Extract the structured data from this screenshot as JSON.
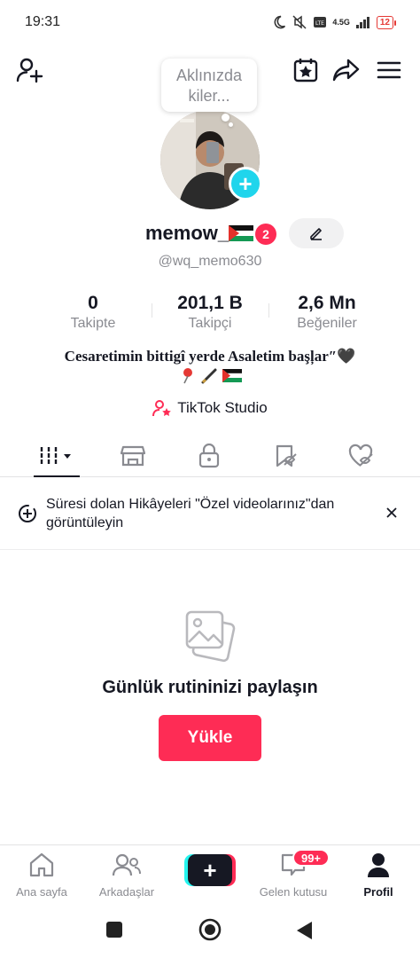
{
  "status_bar": {
    "time": "19:31",
    "battery": "12",
    "network": "4.5G"
  },
  "profile": {
    "bubble_text": "Aklınızda kiler...",
    "username": "memow_",
    "notification_count": "2",
    "handle": "@wq_memo630",
    "stats": [
      {
        "value": "0",
        "label": "Takipte"
      },
      {
        "value": "201,1 B",
        "label": "Takipçi"
      },
      {
        "value": "2,6 Mn",
        "label": "Beğeniler"
      }
    ],
    "bio": "Cesaretimin bittigî yerde Asaletim başļar″🖤",
    "studio_label": "TikTok Studio"
  },
  "banner": {
    "text": "Süresi dolan Hikâyeleri \"Özel videolarınız\"dan görüntüleyin"
  },
  "empty_state": {
    "title": "Günlük rutininizi paylaşın",
    "button": "Yükle"
  },
  "bottom_nav": {
    "items": [
      {
        "label": "Ana sayfa"
      },
      {
        "label": "Arkadaşlar"
      },
      {
        "label": ""
      },
      {
        "label": "Gelen kutusu"
      },
      {
        "label": "Profil"
      }
    ],
    "inbox_badge": "99+"
  },
  "colors": {
    "accent": "#fe2c55",
    "cyan": "#25f4ee",
    "text": "#161823",
    "muted": "#8a8b91"
  }
}
